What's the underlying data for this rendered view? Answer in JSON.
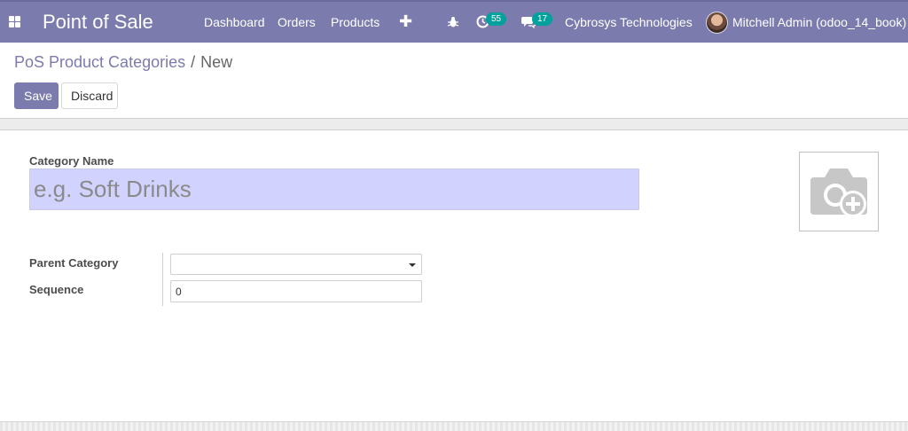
{
  "navbar": {
    "brand": "Point of Sale",
    "menu": [
      "Dashboard",
      "Orders",
      "Products"
    ],
    "activity_count": "55",
    "message_count": "17",
    "company": "Cybrosys Technologies",
    "user": "Mitchell Admin (odoo_14_book)",
    "color": "#7c7bad",
    "badge_color": "#00a09d",
    "icons": [
      "apps-icon",
      "plus-icon",
      "bug-icon",
      "activity-icon",
      "chat-icon"
    ]
  },
  "breadcrumb": {
    "parent": "PoS Product Categories",
    "separator": "/",
    "current": "New"
  },
  "buttons": {
    "save": "Save",
    "discard": "Discard"
  },
  "form": {
    "name_label": "Category Name",
    "name_placeholder": "e.g. Soft Drinks",
    "parent_label": "Parent Category",
    "parent_value": "",
    "sequence_label": "Sequence",
    "sequence_value": "0",
    "image_icon": "camera-add-icon"
  }
}
